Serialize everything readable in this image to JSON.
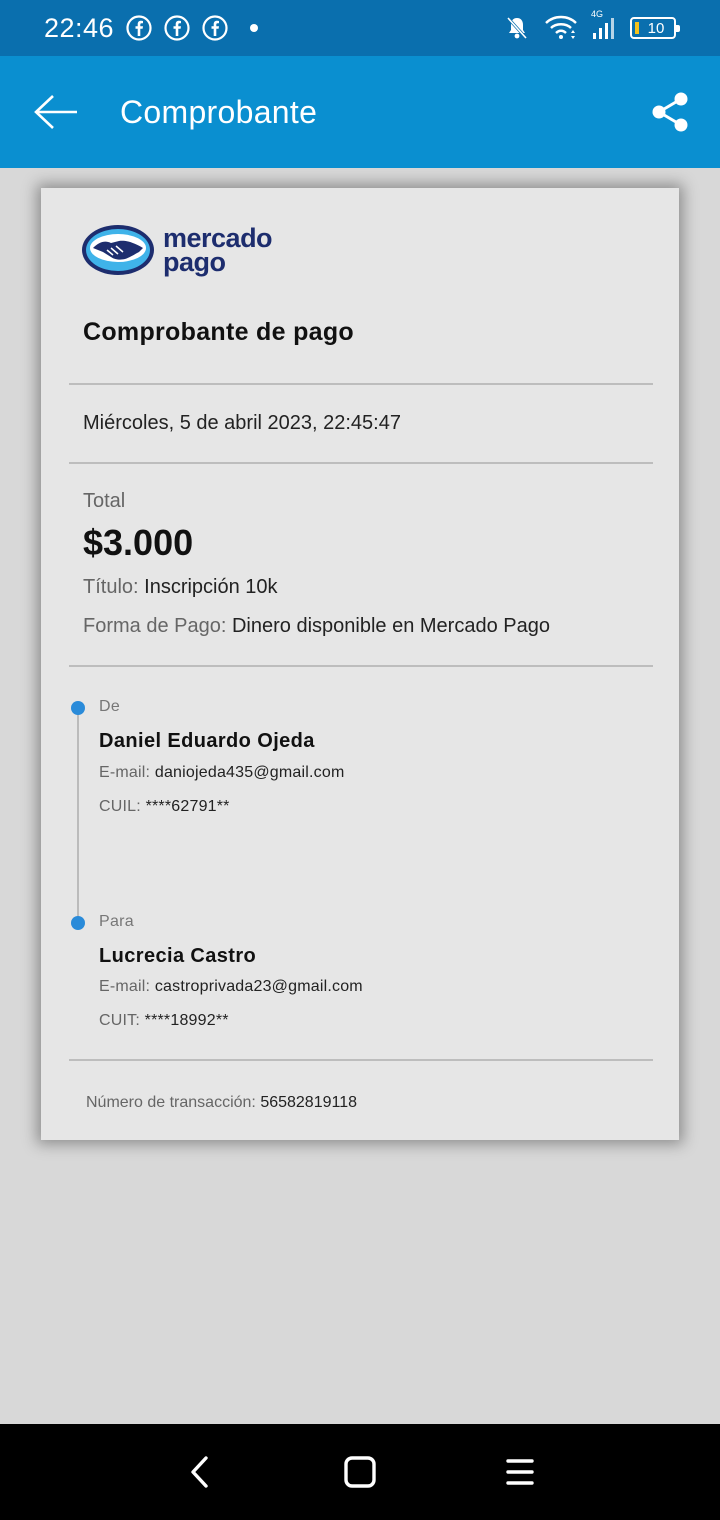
{
  "status_bar": {
    "time": "22:46",
    "network": "4G",
    "battery": "10",
    "icons": [
      "facebook-icon",
      "facebook-icon",
      "facebook-icon",
      "notification-dot",
      "bell-muted-icon",
      "wifi-icon",
      "signal-icon",
      "battery-icon"
    ]
  },
  "app_bar": {
    "title": "Comprobante",
    "back_icon": "arrow-left-icon",
    "share_icon": "share-icon"
  },
  "receipt": {
    "logo_text_line1": "mercado",
    "logo_text_line2": "pago",
    "title": "Comprobante de pago",
    "date": "Miércoles, 5 de abril 2023, 22:45:47",
    "total_label": "Total",
    "total_value": "$3.000",
    "titulo_label": "Título:",
    "titulo_value": "Inscripción 10k",
    "forma_label": "Forma de Pago:",
    "forma_value": "Dinero disponible en Mercado Pago",
    "from": {
      "label": "De",
      "name": "Daniel Eduardo Ojeda",
      "email_label": "E-mail:",
      "email": "daniojeda435@gmail.com",
      "id_label": "CUIL:",
      "id": "****62791**"
    },
    "to": {
      "label": "Para",
      "name": "Lucrecia Castro",
      "email_label": "E-mail:",
      "email": "castroprivada23@gmail.com",
      "id_label": "CUIT:",
      "id": "****18992**"
    },
    "txn_label": "Número de transacción:",
    "txn_value": "56582819118"
  },
  "colors": {
    "status_bar": "#0a6fae",
    "app_bar": "#0a8fd0",
    "timeline_dot": "#2a8bd9",
    "logo_blue": "#1d2d6e"
  }
}
